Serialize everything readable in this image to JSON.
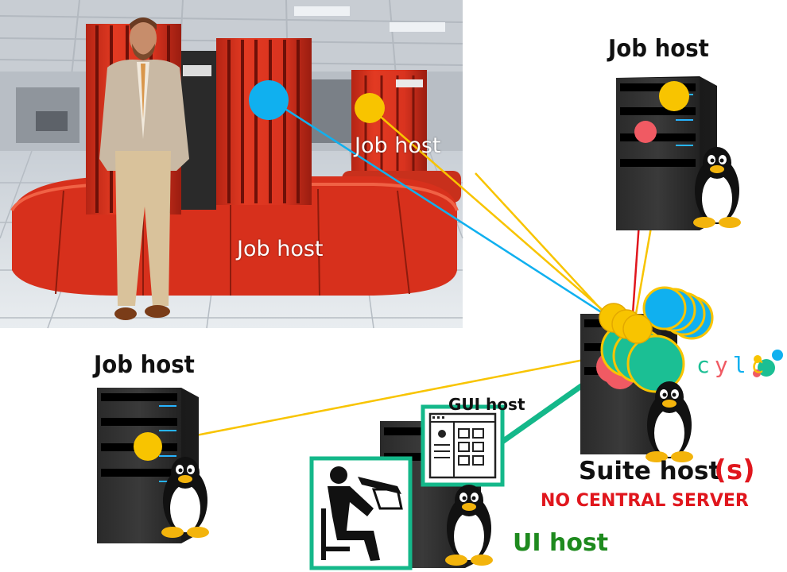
{
  "labels": {
    "job_host_top_right": "Job host",
    "job_host_photo_upper": "Job host",
    "job_host_photo_lower": "Job host",
    "job_host_left": "Job host",
    "gui_host": "GUI host",
    "suite_host": "Suite host",
    "suite_host_suffix": "(s)",
    "no_central_server": "NO CENTRAL SERVER",
    "ui_host": "UI host",
    "cylc_logo": "cylc"
  },
  "colors": {
    "blue": "#10b0ef",
    "yellow": "#f8c400",
    "red": "#f05a63",
    "teal": "#1bbf94",
    "ui_frame": "#14b88a",
    "cray_red": "#d9331f",
    "label_red": "#e0161d",
    "label_green": "#1e8a1e"
  },
  "icons": [
    "tux-penguin-icon",
    "server-tower-icon",
    "gui-window-icon",
    "user-at-desk-icon",
    "cylc-logo-icon"
  ]
}
